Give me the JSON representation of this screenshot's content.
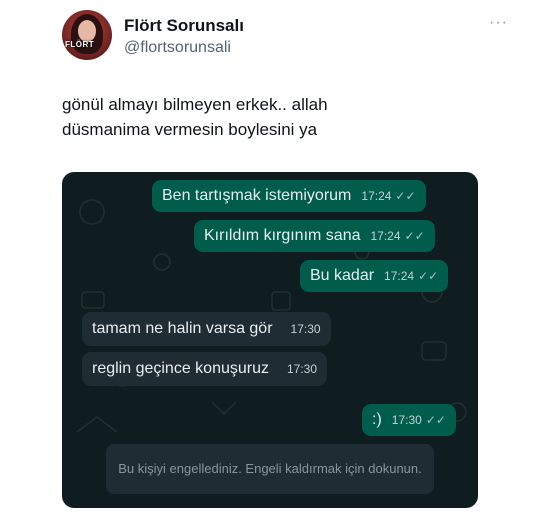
{
  "tweet": {
    "author_name": "Flört Sorunsalı",
    "author_handle": "@flortsorunsali",
    "avatar_label": "FLÖRT",
    "more_label": "···",
    "text_line1": "gönül almayı bilmeyen erkek.. allah",
    "text_line2": "düsmanima vermesin boylesini ya"
  },
  "chat": {
    "messages": [
      {
        "direction": "outgoing",
        "text": "Ben tartışmak istemiyorum",
        "time": "17:24",
        "ticks": "✓✓"
      },
      {
        "direction": "outgoing",
        "text": "Kırıldım kırgınım sana",
        "time": "17:24",
        "ticks": "✓✓"
      },
      {
        "direction": "outgoing",
        "text": "Bu kadar",
        "time": "17:24",
        "ticks": "✓✓"
      },
      {
        "direction": "incoming",
        "text": "tamam ne halin varsa gör",
        "time": "17:30"
      },
      {
        "direction": "incoming",
        "text": "reglin geçince konuşuruz",
        "time": "17:30"
      },
      {
        "direction": "outgoing",
        "text": ":)",
        "time": "17:30",
        "ticks": "✓✓"
      }
    ],
    "blocked_notice": "Bu kişiyi engellediniz. Engeli kaldırmak için dokunun."
  },
  "colors": {
    "chat_background": "#0f1d21",
    "outgoing_bubble": "#005c4b",
    "incoming_bubble": "#1f2c33"
  }
}
